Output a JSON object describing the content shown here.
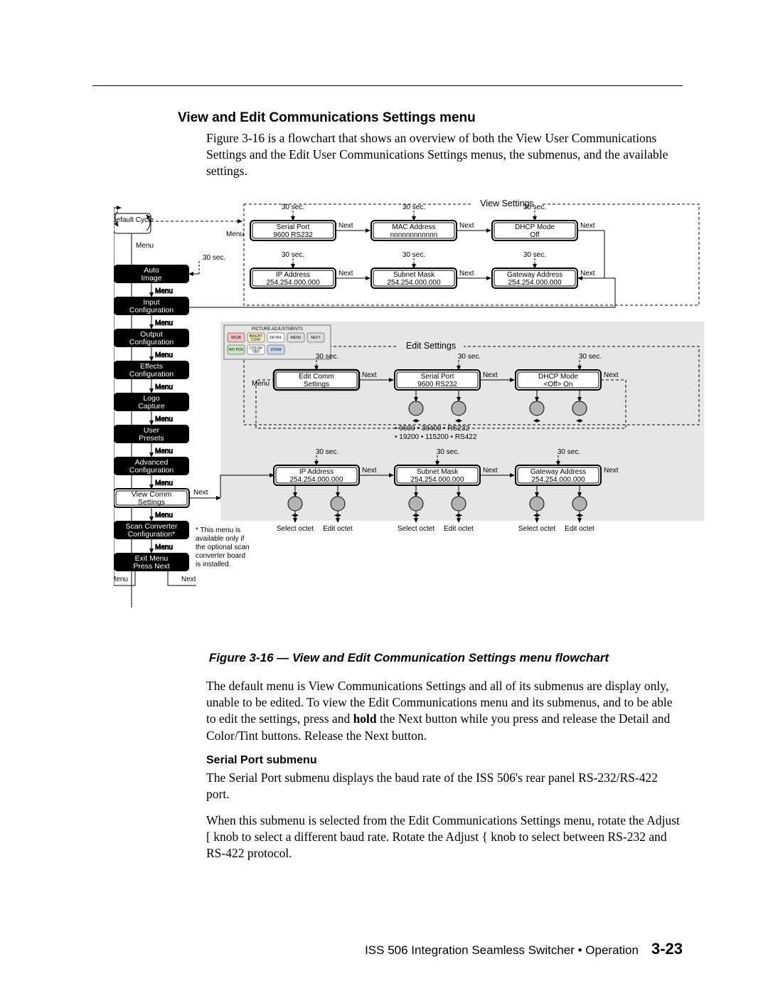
{
  "section_heading": "View and Edit Communications Settings menu",
  "intro": "Figure 3-16 is a flowchart that shows an overview of both the View User Communications Settings and the Edit User Communications Settings menus, the submenus, and the available settings.",
  "figure_caption": "Figure 3-16 — View and Edit Communication Settings menu flowchart",
  "p_after_fig_a": "The default menu is View Communications Settings and all of its submenus are display only, unable to be edited.  To view the Edit Communications menu and its submenus, and to be able to edit the settings, press and ",
  "p_after_fig_bold": "hold",
  "p_after_fig_b": " the Next button while you press and release the Detail and Color/Tint buttons.  Release the Next button.",
  "sub_heading": "Serial Port submenu",
  "sub_p1": "The Serial Port submenu displays the baud rate of the ISS 506's rear panel RS-232/RS-422 port.",
  "sub_p2": "When this submenu is selected from the Edit Communications Settings menu, rotate the Adjust [ knob to select a different baud rate.  Rotate the Adjust { knob to select between RS-232 and RS-422 protocol.",
  "footer_text": "ISS 506 Integration Seamless Switcher • Operation",
  "footer_page": "3-23",
  "diagram": {
    "group_view": "View Settings",
    "group_edit": "Edit Settings",
    "default_cycle": "Default Cycle",
    "t30": "30 sec.",
    "menu": "Menu",
    "next": "Next",
    "left_menu": [
      "Auto Image",
      "Input Configuration",
      "Output Configuration",
      "Effects Configuration",
      "Logo Capture",
      "User Presets",
      "Advanced Configuration",
      "View Comm Settings",
      "Scan Converter Configuration*",
      "Exit Menu Press Next"
    ],
    "view_row1": [
      {
        "t": "Serial Port",
        "b": "9600         RS232"
      },
      {
        "t": "MAC Address",
        "b": "nnnnnnnnnnnn"
      },
      {
        "t": "DHCP Mode",
        "b": "Off"
      }
    ],
    "view_row2": [
      {
        "t": "IP Address",
        "b": "254.254.000.000"
      },
      {
        "t": "Subnet Mask",
        "b": "254.254.000.000"
      },
      {
        "t": "Gateway Address",
        "b": "254.254.000.000"
      }
    ],
    "edit_row1": [
      {
        "t": "Edit Comm",
        "b": "Settings"
      },
      {
        "t": "Serial Port",
        "b": "9600         RS232"
      },
      {
        "t": "DHCP Mode",
        "b": "<Off>         On"
      }
    ],
    "edit_row2": [
      {
        "t": "IP Address",
        "b": "254.254.000.000"
      },
      {
        "t": "Subnet Mask",
        "b": "254.254.000.000"
      },
      {
        "t": "Gateway Address",
        "b": "254.254.000.000"
      }
    ],
    "baud_list": "•  9600   • 38400    •  RS232",
    "baud_list2": "•  19200 • 115200   •  RS422",
    "select_octet": "Select octet",
    "edit_octet": "Edit octet",
    "note": "*  This menu is available only if the optional scan converter board is installed.",
    "pic_adj": "PICTURE ADJUSTMENTS",
    "btns": [
      "R/G/B",
      "BRIGHT CONT",
      "DETAIL",
      "MENU",
      "NEXT",
      "H/V POS",
      "COLOR TINT",
      "ZOOM"
    ]
  }
}
